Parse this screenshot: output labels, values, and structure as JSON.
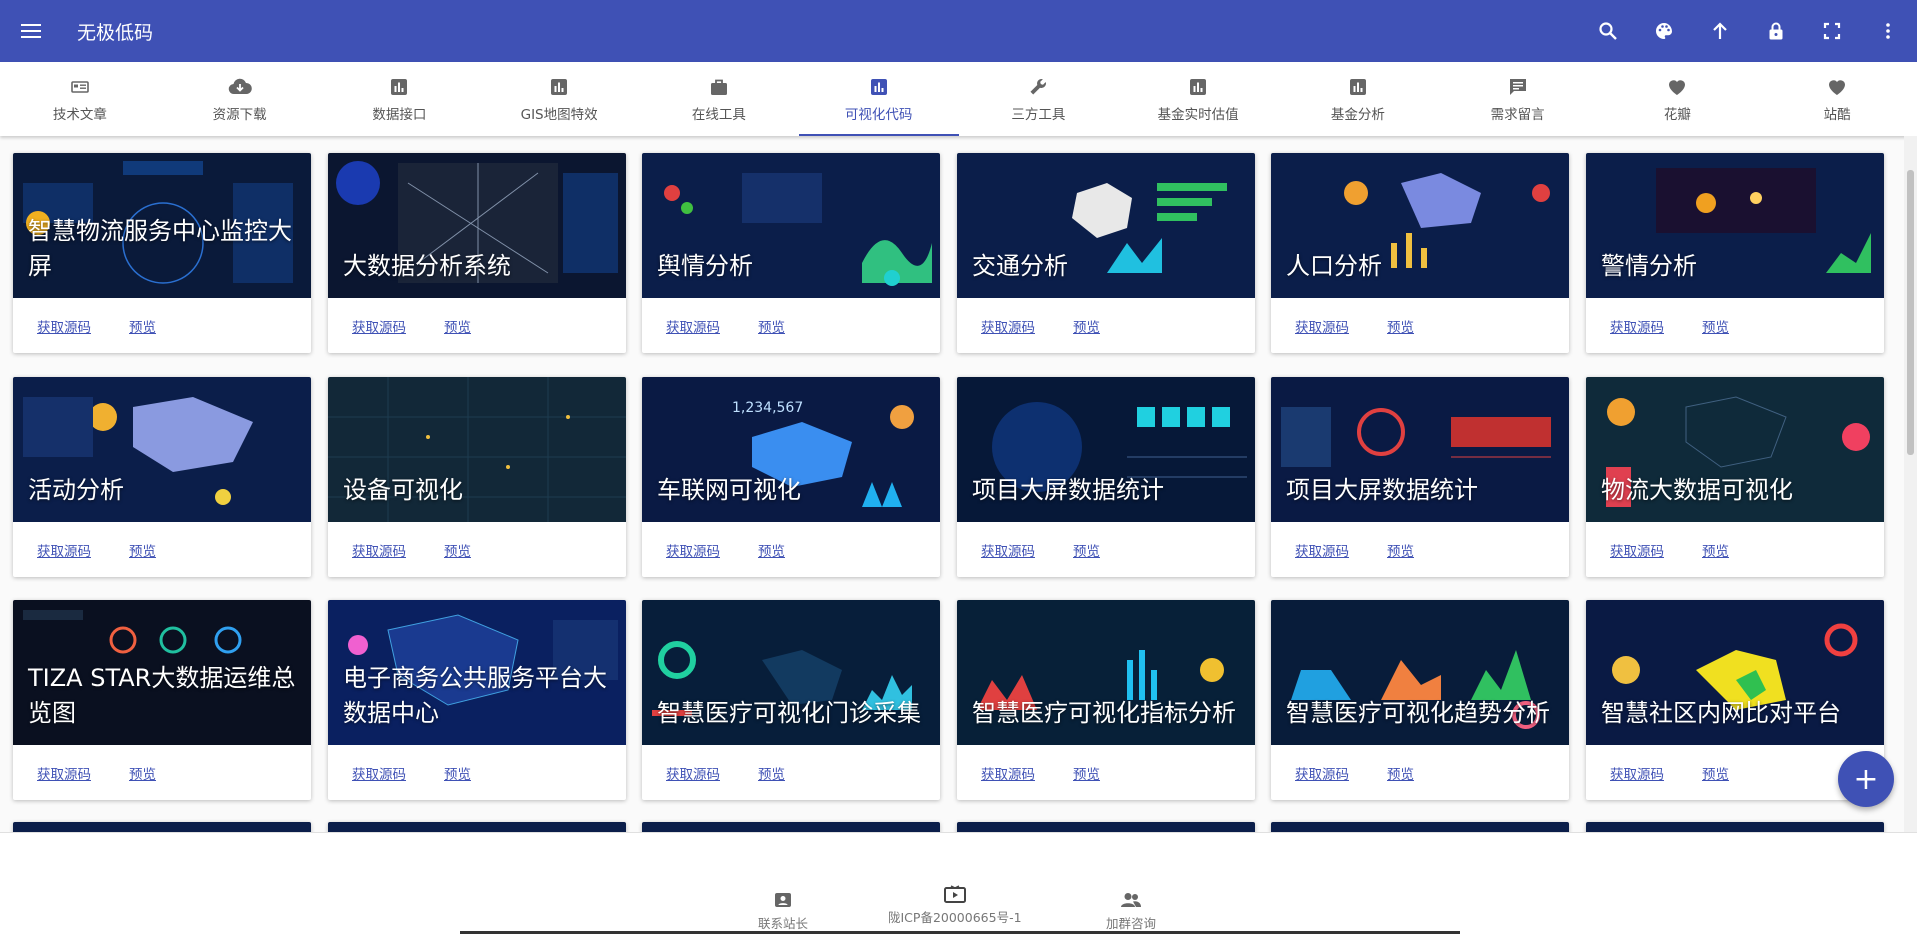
{
  "app": {
    "title": "无极低码"
  },
  "colors": {
    "primary": "#3f51b5",
    "tab_text": "#555555",
    "link": "#3f51b5"
  },
  "header_actions": [
    {
      "name": "search-icon"
    },
    {
      "name": "palette-icon"
    },
    {
      "name": "arrow-up-icon"
    },
    {
      "name": "lock-icon"
    },
    {
      "name": "fullscreen-icon"
    },
    {
      "name": "more-vert-icon"
    }
  ],
  "tabs": [
    {
      "label": "技术文章",
      "icon": "article-icon",
      "active": false
    },
    {
      "label": "资源下载",
      "icon": "cloud-download-icon",
      "active": false
    },
    {
      "label": "数据接口",
      "icon": "bar-chart-icon",
      "active": false
    },
    {
      "label": "GIS地图特效",
      "icon": "bar-chart-icon",
      "active": false
    },
    {
      "label": "在线工具",
      "icon": "work-icon",
      "active": false
    },
    {
      "label": "可视化代码",
      "icon": "bar-chart-icon",
      "active": true
    },
    {
      "label": "三方工具",
      "icon": "wrench-icon",
      "active": false
    },
    {
      "label": "基金实时估值",
      "icon": "bar-chart-icon",
      "active": false
    },
    {
      "label": "基金分析",
      "icon": "bar-chart-icon",
      "active": false
    },
    {
      "label": "需求留言",
      "icon": "comment-icon",
      "active": false
    },
    {
      "label": "花瓣",
      "icon": "heart-icon",
      "active": false
    },
    {
      "label": "站酷",
      "icon": "heart-icon",
      "active": false
    }
  ],
  "card_links": {
    "source": "获取源码",
    "preview": "预览"
  },
  "cards": [
    {
      "title": "智慧物流服务中心监控大屏"
    },
    {
      "title": "大数据分析系统"
    },
    {
      "title": "舆情分析"
    },
    {
      "title": "交通分析"
    },
    {
      "title": "人口分析"
    },
    {
      "title": "警情分析"
    },
    {
      "title": "活动分析"
    },
    {
      "title": "设备可视化"
    },
    {
      "title": "车联网可视化"
    },
    {
      "title": "项目大屏数据统计"
    },
    {
      "title": "项目大屏数据统计"
    },
    {
      "title": "物流大数据可视化"
    },
    {
      "title": "TIZA STAR大数据运维总览图"
    },
    {
      "title": "电子商务公共服务平台大数据中心"
    },
    {
      "title": "智慧医疗可视化门诊采集"
    },
    {
      "title": "智慧医疗可视化指标分析"
    },
    {
      "title": "智慧医疗可视化趋势分析"
    },
    {
      "title": "智慧社区内网比对平台"
    }
  ],
  "fab": {
    "label": "+"
  },
  "footer": {
    "contact": "联系站长",
    "icp": "陇ICP备20000665号-1",
    "group": "加群咨询"
  }
}
